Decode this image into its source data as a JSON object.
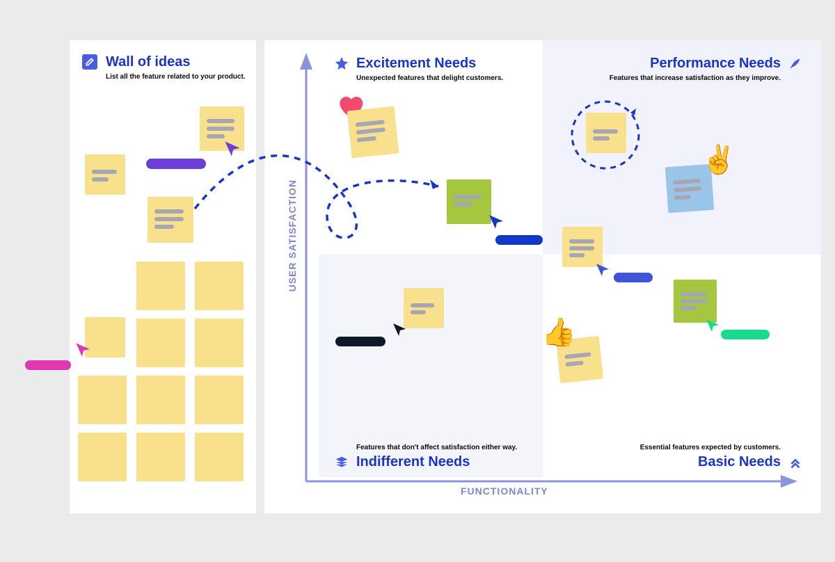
{
  "wall": {
    "title": "Wall of ideas",
    "subtitle": "List all the feature related to your product."
  },
  "quadrants": {
    "excitement": {
      "title": "Excitement Needs",
      "subtitle": "Unexpected features that delight customers."
    },
    "performance": {
      "title": "Performance Needs",
      "subtitle": "Features that increase satisfaction as they improve."
    },
    "indifferent": {
      "title": "Indifferent Needs",
      "subtitle": "Features that don't affect satisfaction either way."
    },
    "basic": {
      "title": "Basic Needs",
      "subtitle": "Essential features expected by customers."
    }
  },
  "axes": {
    "x": "FUNCTIONALITY",
    "y": "USER SATISFACTION"
  },
  "colors": {
    "brandBlue": "#1A35C6",
    "axisPurple": "#8A93DB",
    "noteYellow": "#F8E08C",
    "noteGreen": "#A5C63F",
    "noteBlue": "#9AC4E8",
    "cursorMagenta": "#E038B0",
    "cursorPurple": "#6C3FD9",
    "cursorDarkBlue": "#1238C8",
    "cursorMidBlue": "#3E55D8",
    "cursorBlack": "#0F172A",
    "cursorGreen": "#19D98A",
    "pillMagenta": "#E038B0",
    "pillPurple": "#6C3FD9",
    "pillDarkBlue": "#1238C8",
    "pillMidBlue": "#3E55D8",
    "pillBlack": "#0F172A",
    "pillGreen": "#19D98A",
    "heartRed": "#F24A6E"
  },
  "icons": {
    "edit": "edit-square-icon",
    "star": "star-icon",
    "rocket": "rocket-icon",
    "layers": "layers-icon",
    "chevrons": "chevrons-up-icon",
    "heart": "heart-icon",
    "thumbsUp": "thumbs-up-emoji",
    "victory": "victory-hand-emoji"
  }
}
